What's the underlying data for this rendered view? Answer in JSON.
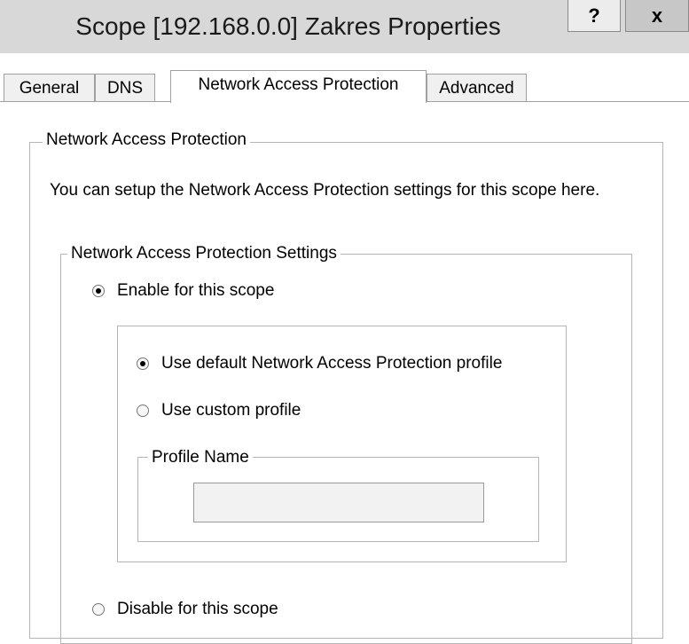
{
  "window": {
    "title": "Scope [192.168.0.0] Zakres Properties",
    "help_label": "?",
    "close_label": "x"
  },
  "tabs": [
    {
      "label": "General",
      "active": false
    },
    {
      "label": "DNS",
      "active": false
    },
    {
      "label": "Network Access Protection",
      "active": true
    },
    {
      "label": "Advanced",
      "active": false
    }
  ],
  "nap_group": {
    "legend": "Network Access Protection",
    "description": "You can setup the Network Access Protection settings for this scope here."
  },
  "settings_group": {
    "legend": "Network Access Protection Settings",
    "enable": {
      "label": "Enable for this scope",
      "selected": true
    },
    "disable": {
      "label": "Disable for this scope",
      "selected": false
    }
  },
  "profile": {
    "default": {
      "label": "Use default Network Access Protection profile",
      "selected": true
    },
    "custom": {
      "label": "Use custom profile",
      "selected": false
    },
    "name_group": {
      "legend": "Profile Name",
      "value": ""
    }
  }
}
